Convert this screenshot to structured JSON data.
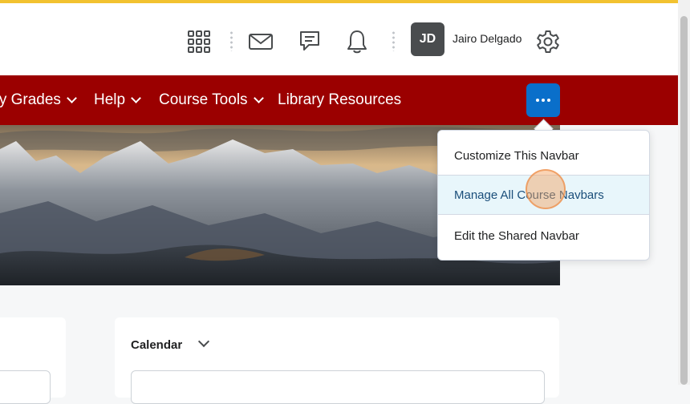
{
  "header": {
    "user_initials": "JD",
    "user_name": "Jairo Delgado",
    "icons": [
      "apps-grid-icon",
      "mail-icon",
      "chat-icon",
      "bell-icon",
      "gear-icon"
    ]
  },
  "navbar": {
    "items": [
      {
        "label": "My Grades",
        "has_chevron": true
      },
      {
        "label": "Help",
        "has_chevron": true
      },
      {
        "label": "Course Tools",
        "has_chevron": true
      },
      {
        "label": "Library Resources",
        "has_chevron": false
      }
    ],
    "more_icon": "more-dots-icon"
  },
  "dropdown": {
    "items": [
      {
        "label": "Customize This Navbar"
      },
      {
        "label": "Manage All Course Navbars",
        "active": true
      },
      {
        "label": "Edit the Shared Navbar"
      }
    ]
  },
  "widgets": {
    "calendar_title": "Calendar"
  },
  "colors": {
    "navbar_bg": "#9b0000",
    "accent_blue": "#0a6fca",
    "top_accent": "#f2c230"
  }
}
